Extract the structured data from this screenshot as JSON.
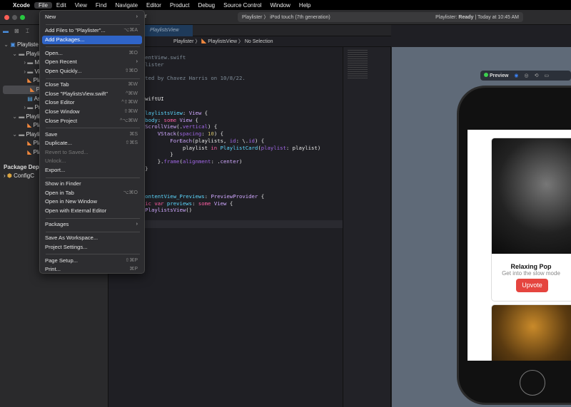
{
  "menubar": {
    "apple": "",
    "items": [
      "Xcode",
      "File",
      "Edit",
      "View",
      "Find",
      "Navigate",
      "Editor",
      "Product",
      "Debug",
      "Source Control",
      "Window",
      "Help"
    ]
  },
  "toolbar": {
    "project": "Playlister",
    "title_fragment": "r",
    "device": "iPod touch (7th generation)",
    "status_prefix": "Playlister: ",
    "status": "Ready",
    "status_time": "| Today at 10:45 AM"
  },
  "sidebar": {
    "items": [
      {
        "label": "Playliste",
        "level": 0,
        "icon": "project-icon"
      },
      {
        "label": "Playlis",
        "level": 1,
        "icon": "folder-icon"
      },
      {
        "label": "Mod",
        "level": 2,
        "icon": "folder-icon"
      },
      {
        "label": "View",
        "level": 2,
        "icon": "folder-icon"
      },
      {
        "label": "Play",
        "level": 2,
        "icon": "swift-file-icon"
      },
      {
        "label": "Play",
        "level": 2,
        "icon": "swift-file-icon",
        "selected": true
      },
      {
        "label": "Ass",
        "level": 2,
        "icon": "assets-icon"
      },
      {
        "label": "Prev",
        "level": 2,
        "icon": "folder-icon"
      },
      {
        "label": "Playlis",
        "level": 1,
        "icon": "folder-icon"
      },
      {
        "label": "Play",
        "level": 2,
        "icon": "swift-file-icon"
      },
      {
        "label": "Playlis",
        "level": 1,
        "icon": "folder-icon"
      },
      {
        "label": "Play",
        "level": 2,
        "icon": "swift-file-icon"
      },
      {
        "label": "Play",
        "level": 2,
        "icon": "swift-file-icon"
      }
    ],
    "section": "Package Depe",
    "package": "ConfigC"
  },
  "editor": {
    "tab": "PlaylistsView",
    "breadcrumb": [
      "Playlister",
      "PlaylistsView",
      "No Selection"
    ]
  },
  "file_menu": {
    "items": [
      {
        "label": "New",
        "submenu": true
      },
      {
        "sep": true
      },
      {
        "label": "Add Files to \"Playlister\"...",
        "shortcut": "⌥⌘A"
      },
      {
        "label": "Add Packages...",
        "highlighted": true
      },
      {
        "sep": true
      },
      {
        "label": "Open...",
        "shortcut": "⌘O"
      },
      {
        "label": "Open Recent",
        "submenu": true
      },
      {
        "label": "Open Quickly...",
        "shortcut": "⇧⌘O"
      },
      {
        "sep": true
      },
      {
        "label": "Close Tab",
        "shortcut": "⌘W"
      },
      {
        "label": "Close \"PlaylistsView.swift\"",
        "shortcut": "^⌘W"
      },
      {
        "label": "Close Editor",
        "shortcut": "^⇧⌘W"
      },
      {
        "label": "Close Window",
        "shortcut": "⇧⌘W"
      },
      {
        "label": "Close Project",
        "shortcut": "^⌥⌘W"
      },
      {
        "sep": true
      },
      {
        "label": "Save",
        "shortcut": "⌘S"
      },
      {
        "label": "Duplicate...",
        "shortcut": "⇧⌘S"
      },
      {
        "label": "Revert to Saved...",
        "disabled": true
      },
      {
        "label": "Unlock...",
        "disabled": true
      },
      {
        "label": "Export..."
      },
      {
        "sep": true
      },
      {
        "label": "Show in Finder"
      },
      {
        "label": "Open in Tab",
        "shortcut": "⌥⌘O"
      },
      {
        "label": "Open in New Window"
      },
      {
        "label": "Open with External Editor"
      },
      {
        "sep": true
      },
      {
        "label": "Packages",
        "submenu": true
      },
      {
        "sep": true
      },
      {
        "label": "Save As Workspace..."
      },
      {
        "label": "Project Settings..."
      },
      {
        "sep": true
      },
      {
        "label": "Page Setup...",
        "shortcut": "⇧⌘P"
      },
      {
        "label": "Print...",
        "shortcut": "⌘P"
      }
    ]
  },
  "code": {
    "lines": [
      {
        "row": 1,
        "html": "<span class='cm'>//</span>"
      },
      {
        "row": 2,
        "html": "<span class='cm'>//  ContentView.swift</span>"
      },
      {
        "row": 3,
        "html": "<span class='cm'>//  Playlister</span>"
      },
      {
        "row": 4,
        "html": "<span class='cm'>//</span>"
      },
      {
        "row": 5,
        "html": "<span class='cm'>//  Created by Chavez Harris on 10/8/22.</span>"
      },
      {
        "row": 6,
        "html": "<span class='cm'>//</span>"
      },
      {
        "row": 8,
        "html": "<span class='kw'>import</span> SwiftUI"
      },
      {
        "row": 10,
        "html": "<span class='kw'>struct</span> <span class='ty'>PlaylistsView</span>: <span class='ty2'>View</span> {"
      },
      {
        "row": 11,
        "html": "    <span class='kw'>var</span> <span class='ty'>body</span>: <span class='kw'>some</span> <span class='ty2'>View</span> {"
      },
      {
        "row": 12,
        "html": "        <span class='ty2'>ScrollView</span>(.<span class='fn'>vertical</span>) {"
      },
      {
        "row": 13,
        "html": "            <span class='ty2'>VStack</span>(<span class='fn'>spacing</span>: <span class='nm'>10</span>) {"
      },
      {
        "row": 14,
        "html": "                <span class='ty2'>ForEach</span>(playlists, <span class='fn'>id</span>: \\.<span class='fn'>id</span>) {"
      },
      {
        "row": 15,
        "html": "                    playlist <span class='kw'>in</span> <span class='ty'>PlaylistCard</span>(<span class='fn'>playlist</span>: playlist)"
      },
      {
        "row": 16,
        "html": "                }"
      },
      {
        "row": 17,
        "html": "            }.<span class='fn'>frame</span>(<span class='fn'>alignment</span>: .<span class='ty2'>center</span>)"
      },
      {
        "row": 18,
        "html": "        }"
      },
      {
        "row": 19,
        "html": "    }"
      },
      {
        "row": 20,
        "html": "}"
      },
      {
        "row": 22,
        "html": "<span class='kw'>struct</span> <span class='ty'>ContentView_Previews</span>: <span class='ty2'>PreviewProvider</span> {"
      },
      {
        "row": 23,
        "html": "    <span class='kw'>static var</span> <span class='ty'>previews</span>: <span class='kw'>some</span> <span class='ty2'>View</span> {"
      },
      {
        "row": 24,
        "html": "        <span class='ty2'>PlaylistsView</span>()"
      },
      {
        "row": 25,
        "html": "    }"
      },
      {
        "row": 26,
        "html": "}"
      }
    ]
  },
  "preview": {
    "label": "Preview",
    "status_color": "#3ccf4e",
    "card": {
      "title": "Relaxing Pop",
      "subtitle": "Get into the slow mode",
      "button": "Upvote",
      "button_color": "#e5453f"
    }
  }
}
